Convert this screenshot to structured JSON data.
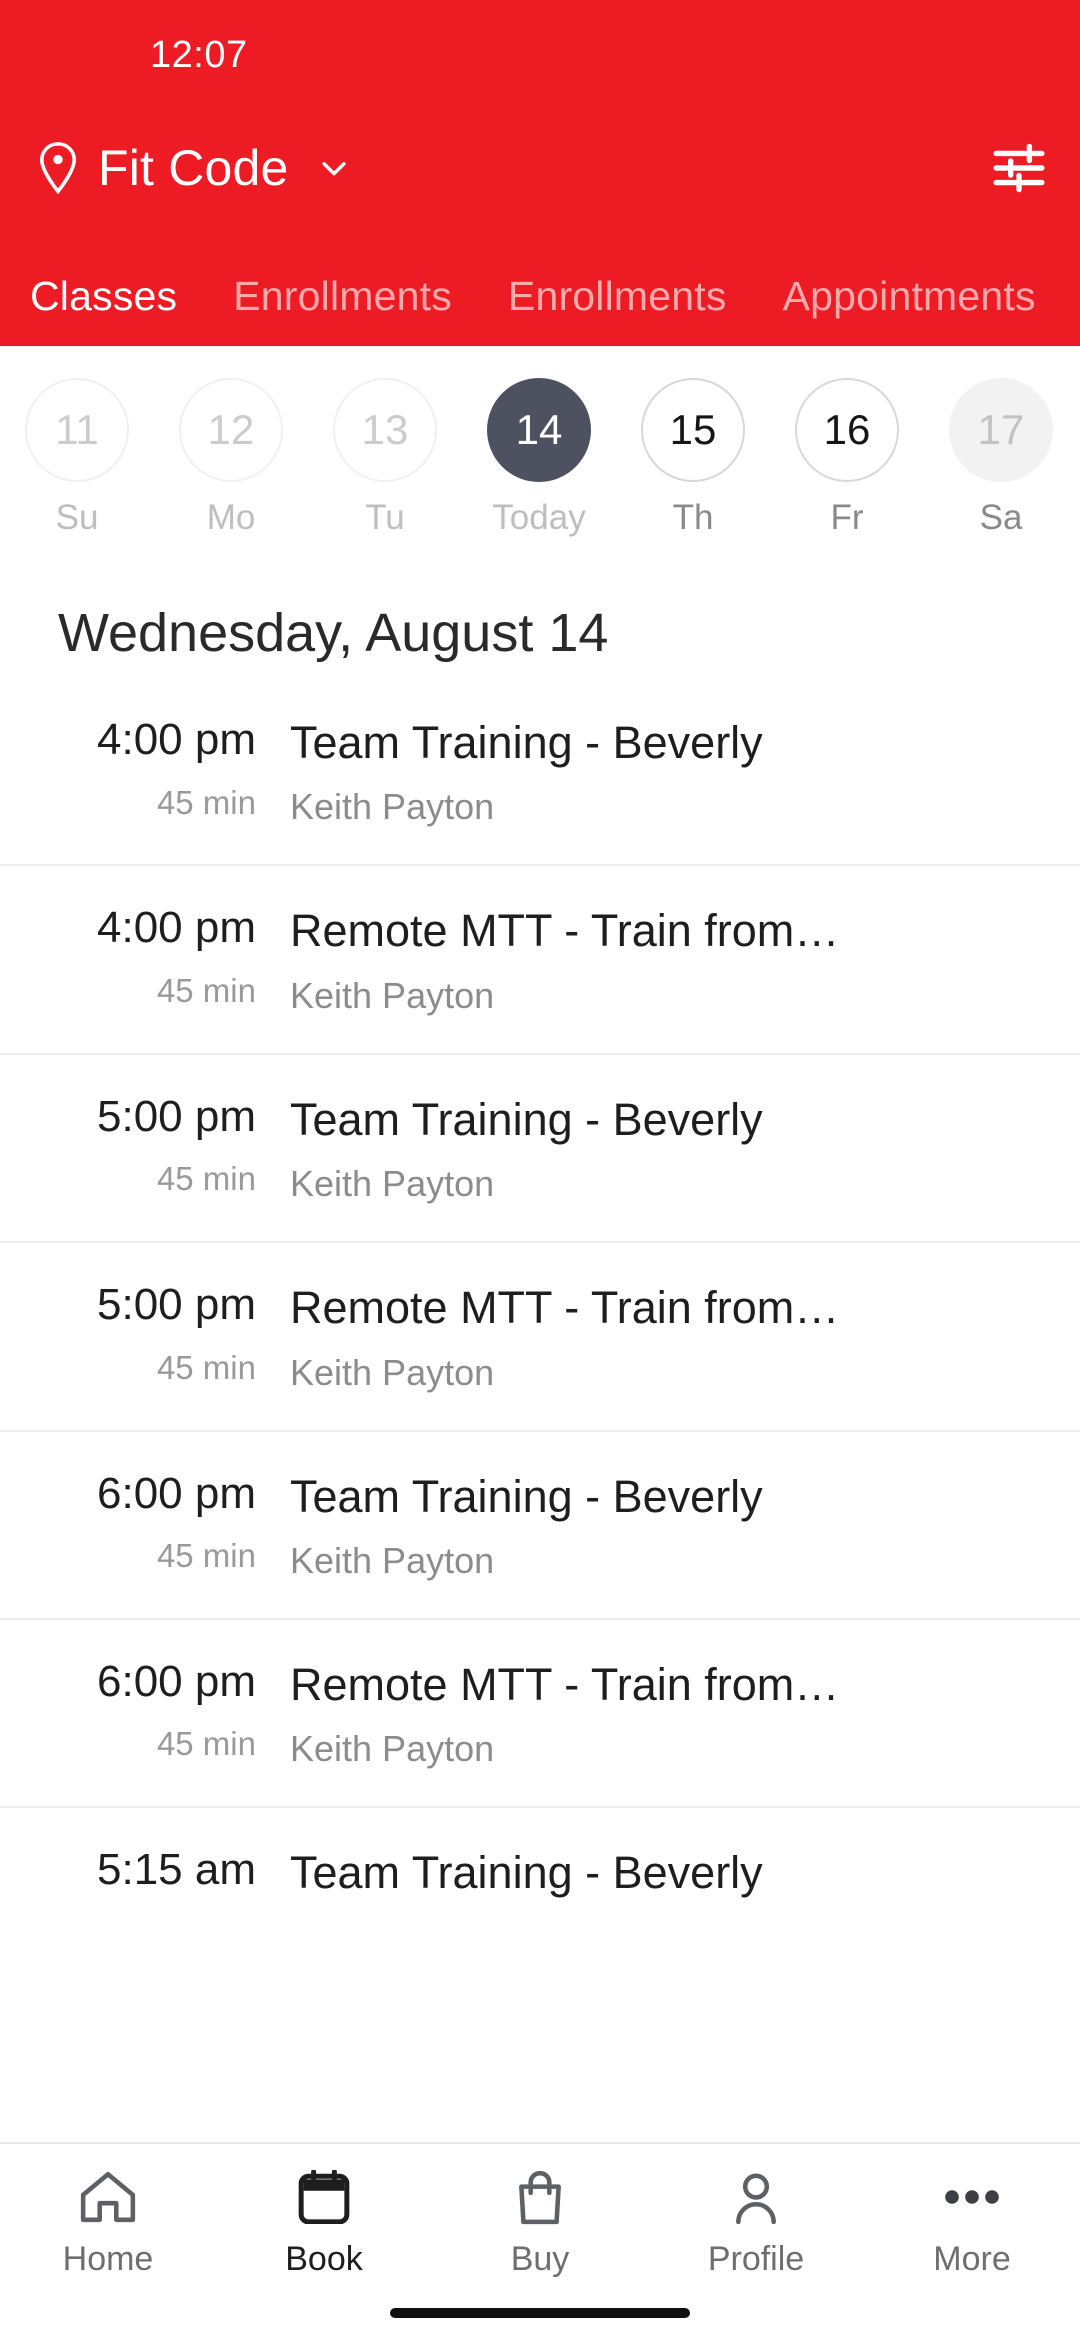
{
  "status_bar": {
    "time": "12:07"
  },
  "header": {
    "location_name": "Fit Code",
    "location_icon": "location-pin-icon",
    "dropdown_icon": "chevron-down-icon",
    "filter_icon": "filter-sliders-icon",
    "background_color": "#ED1C24",
    "tabs": [
      {
        "label": "Classes",
        "active": true
      },
      {
        "label": "Enrollments",
        "active": false
      },
      {
        "label": "Enrollments",
        "active": false
      },
      {
        "label": "Appointments",
        "active": false
      }
    ]
  },
  "date_strip": {
    "days": [
      {
        "num": "11",
        "label": "Su",
        "state": "past"
      },
      {
        "num": "12",
        "label": "Mo",
        "state": "past"
      },
      {
        "num": "13",
        "label": "Tu",
        "state": "past"
      },
      {
        "num": "14",
        "label": "Today",
        "state": "today"
      },
      {
        "num": "15",
        "label": "Th",
        "state": "future"
      },
      {
        "num": "16",
        "label": "Fr",
        "state": "future"
      },
      {
        "num": "17",
        "label": "Sa",
        "state": "dim"
      }
    ],
    "selected_color": "#4E5260"
  },
  "schedule": {
    "date_heading": "Wednesday, August 14",
    "classes": [
      {
        "time": "4:00 pm",
        "duration": "45 min",
        "title": "Team Training - Beverly",
        "instructor": "Keith Payton"
      },
      {
        "time": "4:00 pm",
        "duration": "45 min",
        "title": "Remote MTT - Train from…",
        "instructor": "Keith Payton"
      },
      {
        "time": "5:00 pm",
        "duration": "45 min",
        "title": "Team Training - Beverly",
        "instructor": "Keith Payton"
      },
      {
        "time": "5:00 pm",
        "duration": "45 min",
        "title": "Remote MTT - Train from…",
        "instructor": "Keith Payton"
      },
      {
        "time": "6:00 pm",
        "duration": "45 min",
        "title": "Team Training - Beverly",
        "instructor": "Keith Payton"
      },
      {
        "time": "6:00 pm",
        "duration": "45 min",
        "title": "Remote MTT - Train from…",
        "instructor": "Keith Payton"
      },
      {
        "time": "5:15 am",
        "duration": "",
        "title": "Team Training - Beverly",
        "instructor": ""
      }
    ]
  },
  "bottom_nav": {
    "items": [
      {
        "label": "Home",
        "icon": "home-icon",
        "active": false
      },
      {
        "label": "Book",
        "icon": "calendar-icon",
        "active": true
      },
      {
        "label": "Buy",
        "icon": "shopping-bag-icon",
        "active": false
      },
      {
        "label": "Profile",
        "icon": "person-icon",
        "active": false
      },
      {
        "label": "More",
        "icon": "ellipsis-icon",
        "active": false
      }
    ]
  }
}
